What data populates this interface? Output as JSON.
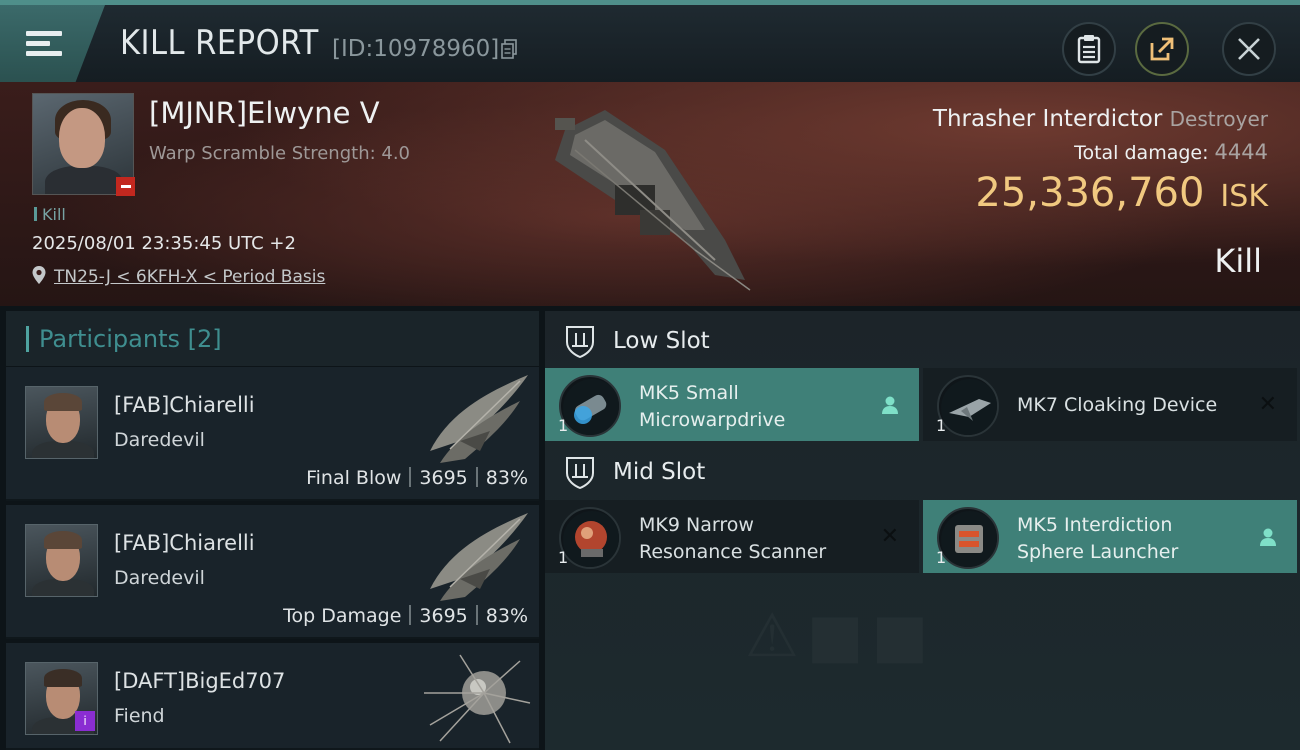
{
  "header": {
    "title": "KILL REPORT",
    "report_id": "[ID:10978960]"
  },
  "victim": {
    "name": "[MJNR]Elwyne V",
    "warp_scramble": "Warp Scramble Strength: 4.0",
    "tag": "Kill",
    "timestamp": "2025/08/01 23:35:45 UTC +2",
    "location": "TN25-J < 6KFH-X < Period Basis",
    "ship_name": "Thrasher Interdictor",
    "ship_class": "Destroyer",
    "total_damage_label": "Total damage:",
    "total_damage": "4444",
    "isk_value": "25,336,760",
    "isk_unit": "ISK",
    "result": "Kill"
  },
  "participants": {
    "label": "Participants",
    "count": "[2]",
    "rows": [
      {
        "name": "[FAB]Chiarelli",
        "ship": "Daredevil",
        "role": "Final Blow",
        "damage": "3695",
        "percent": "83%"
      },
      {
        "name": "[FAB]Chiarelli",
        "ship": "Daredevil",
        "role": "Top Damage",
        "damage": "3695",
        "percent": "83%"
      },
      {
        "name": "[DAFT]BigEd707",
        "ship": "Fiend"
      }
    ]
  },
  "fittings": {
    "low_slot_label": "Low Slot",
    "mid_slot_label": "Mid Slot",
    "low": [
      {
        "line1": "MK5 Small",
        "line2": "Microwarpdrive",
        "qty": "1"
      },
      {
        "line1": "MK7 Cloaking Device",
        "qty": "1"
      }
    ],
    "mid": [
      {
        "line1": "MK9 Narrow",
        "line2": "Resonance Scanner",
        "qty": "1"
      },
      {
        "line1": "MK5 Interdiction",
        "line2": "Sphere Launcher",
        "qty": "1"
      }
    ]
  }
}
